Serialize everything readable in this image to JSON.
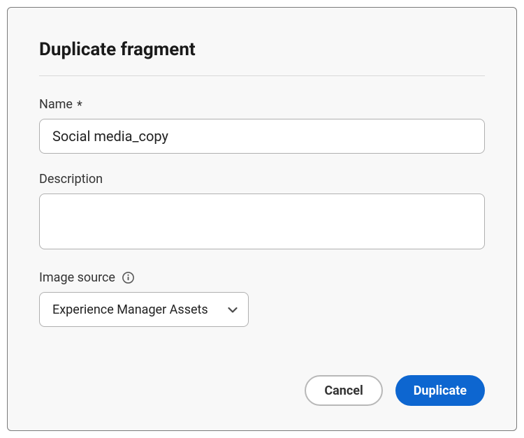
{
  "dialog": {
    "title": "Duplicate fragment"
  },
  "fields": {
    "name": {
      "label": "Name",
      "required_marker": "*",
      "value": "Social media_copy"
    },
    "description": {
      "label": "Description",
      "value": ""
    },
    "image_source": {
      "label": "Image source",
      "selected": "Experience Manager Assets"
    }
  },
  "buttons": {
    "cancel": "Cancel",
    "duplicate": "Duplicate"
  }
}
